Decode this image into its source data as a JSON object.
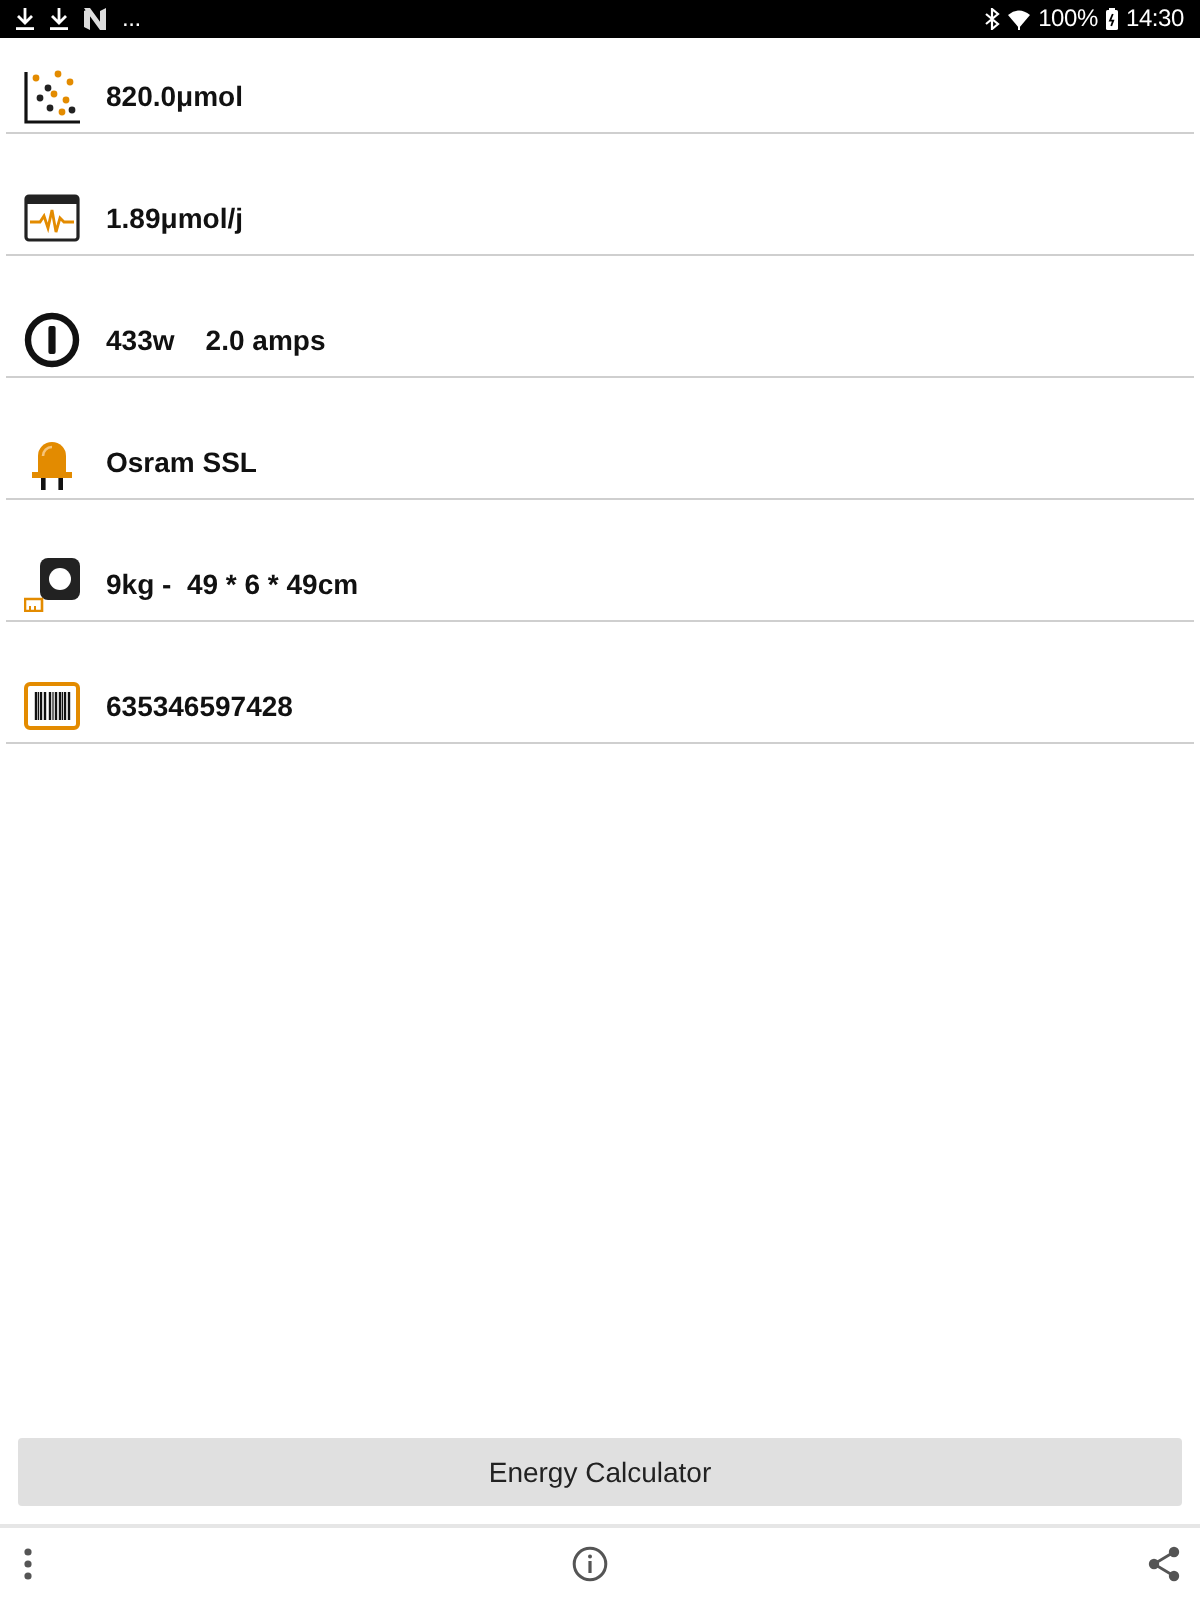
{
  "status_bar": {
    "overflow": "...",
    "battery": "100%",
    "time": "14:30"
  },
  "rows": [
    {
      "kind": "density",
      "text": "820.0μmol"
    },
    {
      "kind": "efficiency",
      "text": "1.89μmol/j"
    },
    {
      "kind": "power",
      "text": "433w    2.0 amps"
    },
    {
      "kind": "brand",
      "text": "Osram SSL"
    },
    {
      "kind": "size",
      "text": "9kg -  49 * 6 * 49cm"
    },
    {
      "kind": "barcode",
      "text": "635346597428"
    }
  ],
  "action_button": {
    "label": "Energy Calculator"
  }
}
